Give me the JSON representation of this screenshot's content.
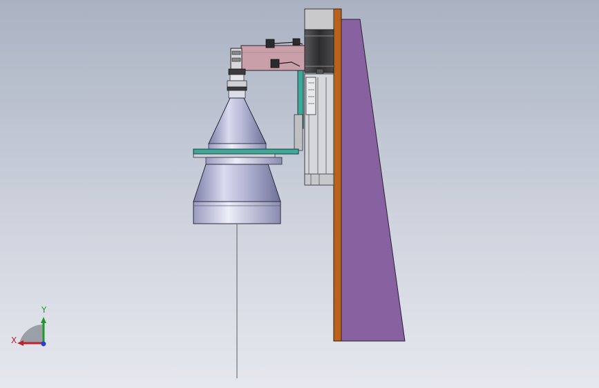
{
  "viewport": {
    "background_top": "#aab2c2",
    "background_bottom": "#e6e8ee"
  },
  "model": {
    "colors": {
      "support_wedge": "#8862a0",
      "mounting_plate": "#b8621e",
      "motor_housing": "#c9c9cb",
      "linear_rail": "#d6d7da",
      "camera_body": "#c9a0aa",
      "bracket": "#3ea89a",
      "light_cone": "#aeb0d0",
      "probe": "#707478"
    }
  },
  "triad": {
    "x_label": "X",
    "y_label": "Y",
    "x_color": "#c0202a",
    "y_color": "#1e9a2a",
    "z_color": "#2b3bd6"
  }
}
